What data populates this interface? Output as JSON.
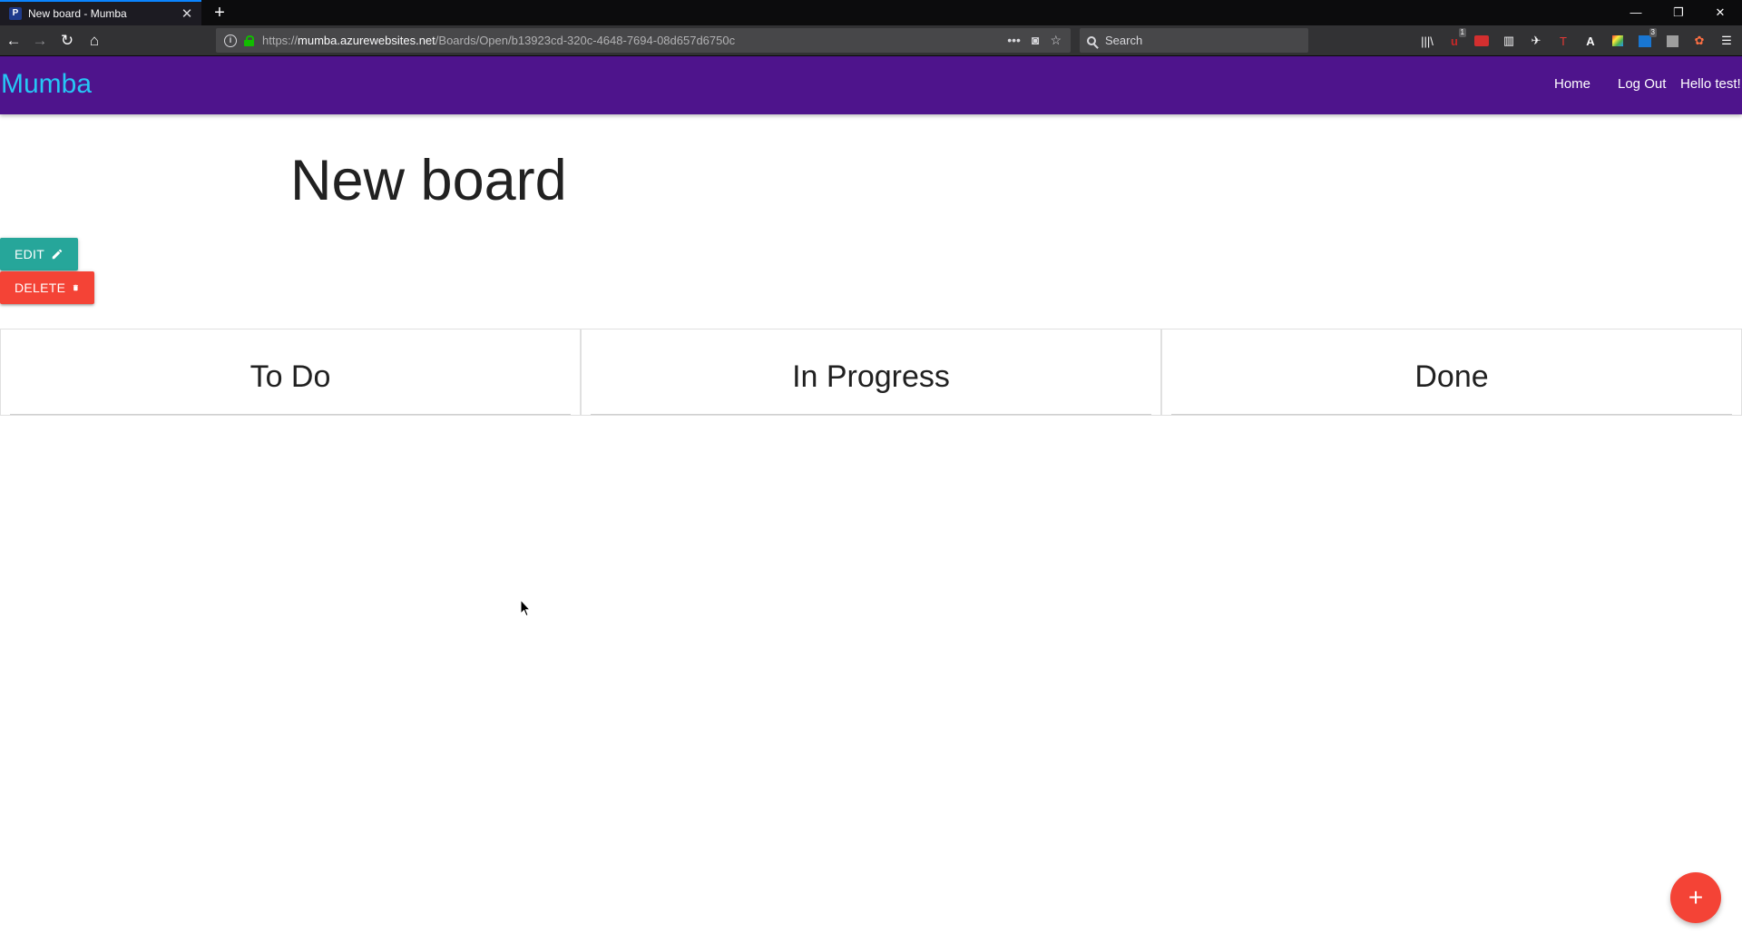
{
  "browser": {
    "tab_title": "New board - Mumba",
    "tab_favicon": "P",
    "new_tab_icon": "+",
    "url_scheme": "https://",
    "url_host": "mumba.azurewebsites.net",
    "url_path": "/Boards/Open/b13923cd-320c-4648-7694-08d657d6750c",
    "search_placeholder": "Search",
    "extension_badges": {
      "ublock": "1",
      "outlook": "3"
    },
    "toolbar_letters": {
      "t": "T",
      "a": "A"
    }
  },
  "site": {
    "brand": "Mumba",
    "brand_color": "#26c6f5",
    "header_color": "#4e148c",
    "nav": {
      "home": "Home",
      "logout": "Log Out",
      "greeting": "Hello test!"
    }
  },
  "board": {
    "title": "New board",
    "edit_label": "EDIT",
    "delete_label": "DELETE",
    "edit_color": "#26a69a",
    "delete_color": "#f44336",
    "columns": [
      {
        "title": "To Do"
      },
      {
        "title": "In Progress"
      },
      {
        "title": "Done"
      }
    ],
    "fab_label": "+"
  }
}
